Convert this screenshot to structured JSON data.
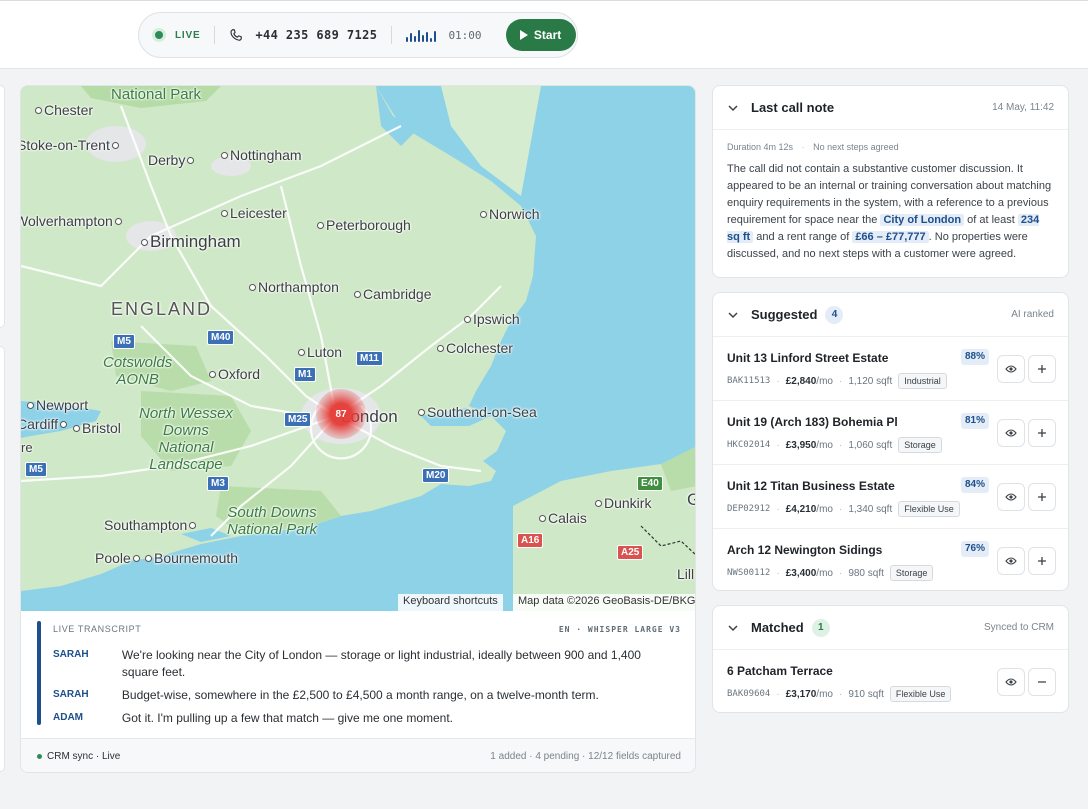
{
  "call_bar": {
    "live_label": "LIVE",
    "phone_number": "+44 235 689 7125",
    "timer": "01:00",
    "start_label": "Start"
  },
  "map": {
    "cluster_count": "87",
    "keyboard_shortcuts": "Keyboard shortcuts",
    "attribution": "Map data ©2026 GeoBasis-DE/BKG",
    "labels": {
      "national_park": "National Park",
      "chester": "Chester",
      "stoke": "Stoke-on-Trent",
      "derby": "Derby",
      "nottingham": "Nottingham",
      "wolverhampton": "Wolverhampton",
      "leicester": "Leicester",
      "peterborough": "Peterborough",
      "norwich": "Norwich",
      "birmingham": "Birmingham",
      "northampton": "Northampton",
      "cambridge": "Cambridge",
      "england": "ENGLAND",
      "ipswich": "Ipswich",
      "luton": "Luton",
      "colchester": "Colchester",
      "cotswolds": "Cotswolds\nAONB",
      "oxford": "Oxford",
      "newport": "Newport",
      "cardiff": "Cardiff",
      "bristol": "Bristol",
      "north_wessex": "North Wessex\nDowns\nNational\nLandscape",
      "london": "London",
      "southend": "Southend-on-Sea",
      "dunkirk": "Dunkirk",
      "calais": "Calais",
      "southampton": "Southampton",
      "south_downs": "South Downs\nNational Park",
      "poole": "Poole",
      "bournemouth": "Bournemouth",
      "lille": "Lill",
      "g": "G",
      "re": "re"
    },
    "roads": {
      "m5a": "M5",
      "m40": "M40",
      "m5b": "M5",
      "m11": "M11",
      "m1": "M1",
      "m25": "M25",
      "m3": "M3",
      "m20": "M20",
      "m5c": "M5",
      "e40": "E40",
      "a16": "A16",
      "a25": "A25"
    }
  },
  "transcript": {
    "heading": "LIVE TRANSCRIPT",
    "model": "EN · WHISPER LARGE V3",
    "lines": [
      {
        "speaker": "SARAH",
        "text": "We're looking near the City of London — storage or light industrial, ideally between 900 and 1,400 square feet."
      },
      {
        "speaker": "SARAH",
        "text": "Budget-wise, somewhere in the £2,500 to £4,500 a month range, on a twelve-month term."
      },
      {
        "speaker": "ADAM",
        "text": "Got it. I'm pulling up a few that match — give me one moment."
      }
    ],
    "crm_sync": "CRM sync · Live",
    "stats": "1 added · 4 pending · 12/12 fields captured"
  },
  "last_call": {
    "title": "Last call note",
    "timestamp": "14 May, 11:42",
    "duration": "Duration 4m 12s",
    "next_steps": "No next steps agreed",
    "text_1": "The call did not contain a substantive customer discussion. It appeared to be an internal or training conversation about matching enquiry requirements in the system, with a reference to a previous requirement for space near the ",
    "hl_location": "City of London",
    "text_2": " of at least ",
    "hl_size": "234 sq ft",
    "text_3": " and a rent range of ",
    "hl_rent": "£66 – £77,777",
    "text_4": ". No properties were discussed, and no next steps with a customer were agreed."
  },
  "suggested": {
    "title": "Suggested",
    "count": "4",
    "meta": "AI ranked",
    "items": [
      {
        "name": "Unit 13 Linford Street Estate",
        "score": "88%",
        "ref": "BAK11513",
        "price": "£2,840",
        "per": "/mo",
        "size": "1,120 sqft",
        "tag": "Industrial"
      },
      {
        "name": "Unit 19 (Arch 183) Bohemia Pl",
        "score": "81%",
        "ref": "HKC02014",
        "price": "£3,950",
        "per": "/mo",
        "size": "1,060 sqft",
        "tag": "Storage"
      },
      {
        "name": "Unit 12 Titan Business Estate",
        "score": "84%",
        "ref": "DEP02912",
        "price": "£4,210",
        "per": "/mo",
        "size": "1,340 sqft",
        "tag": "Flexible Use"
      },
      {
        "name": "Arch 12 Newington Sidings",
        "score": "76%",
        "ref": "NWS00112",
        "price": "£3,400",
        "per": "/mo",
        "size": "980 sqft",
        "tag": "Storage"
      }
    ]
  },
  "matched": {
    "title": "Matched",
    "count": "1",
    "meta": "Synced to CRM",
    "items": [
      {
        "name": "6 Patcham Terrace",
        "ref": "BAK09604",
        "price": "£3,170",
        "per": "/mo",
        "size": "910 sqft",
        "tag": "Flexible Use"
      }
    ]
  },
  "colors": {
    "accent_blue": "#1d4f8c",
    "accent_green": "#2a7a47",
    "cluster_red": "#e53935",
    "sea": "#8ed2e8",
    "land": "#cfe8c7"
  }
}
